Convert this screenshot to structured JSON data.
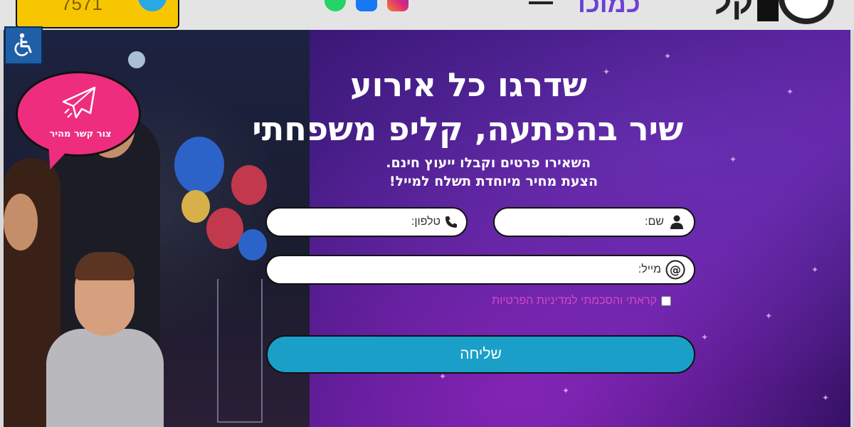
{
  "topbar": {
    "phone_partial": "7571",
    "logo_partial": "קל",
    "logo_sub_partial": "כמוכו"
  },
  "accessibility": {
    "icon": "wheelchair-icon"
  },
  "quick_contact": {
    "label": "צור קשר מהיר",
    "icon": "paper-plane-icon"
  },
  "hero": {
    "headline_line1": "שדרגו כל אירוע",
    "headline_line2": "שיר בהפתעה, קליפ משפחתי",
    "sub_line1": "השאירו פרטים וקבלו ייעוץ חינם.",
    "sub_line2": "הצעת מחיר מיוחדת תשלח למייל!"
  },
  "form": {
    "name_label": "שם:",
    "phone_label": "טלפון:",
    "email_label": "מייל:",
    "consent_label": "קראתי והסכמתי למדיניות הפרטיות",
    "consent_checked": false,
    "submit_label": "שליחה"
  },
  "colors": {
    "submit": "#1aa0c8",
    "consent_text": "#d14ac4",
    "contact_bubble": "#ee2d7e",
    "accessibility": "#1f5fa8",
    "phone_box": "#f7c600"
  }
}
